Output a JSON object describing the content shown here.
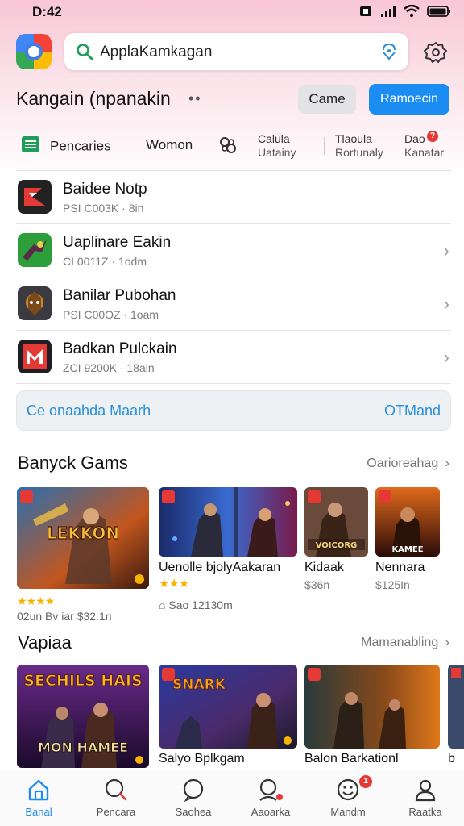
{
  "status_bar": {
    "time": "D:42"
  },
  "search": {
    "value": "ApplaKamkagan"
  },
  "header": {
    "title": "Kangain (npanakin",
    "game_button": "Came",
    "primary_button": "Ramoecin"
  },
  "tabs": [
    {
      "label": "Pencaries"
    },
    {
      "label": "Womon"
    },
    {
      "label": "Calula",
      "sub": "Uatainy"
    },
    {
      "label": "Tlaoula",
      "sub": "Rortunaly"
    },
    {
      "label": "Dao",
      "sub": "Kanatar",
      "badge": "?"
    }
  ],
  "list": [
    {
      "name": "Baidee Notp",
      "meta": "PSI C003K · 8in"
    },
    {
      "name": "Uaplinare Eakin",
      "meta": "CI 0011Z · 1odm"
    },
    {
      "name": "Banilar Pubohan",
      "meta": "PSI C00OZ · 1oam"
    },
    {
      "name": "Badkan Pulckain",
      "meta": "ZCI 9200K · 18ain"
    }
  ],
  "banner": {
    "left": "Ce onaahda Maarh",
    "right": "OTMand"
  },
  "section1": {
    "title": "Banyck Gams",
    "more": "Oarioreahag",
    "cards": [
      {
        "art_text": "LEKKON",
        "caption": "02un Bv iar $32.1n",
        "stars": "★★★★"
      },
      {
        "name": "Uenolle bjolyAakaran",
        "stars": "★★★",
        "caption": "Sao 12130m"
      },
      {
        "name": "Kidaak",
        "price": "$36n",
        "art_text": "VOICORG"
      },
      {
        "name": "Nennara",
        "price": "$125In",
        "art_text": "KAMEE"
      }
    ]
  },
  "section2": {
    "title": "Vapiaa",
    "more": "Mamanabling",
    "cards": [
      {
        "art_text": "SECHILS HAIS",
        "art_text2": "MON HAMEE"
      },
      {
        "name": "Salyo Bplkgam",
        "art_text": "SNARK"
      },
      {
        "name": "Balon Barkationl"
      },
      {
        "name": "b"
      }
    ]
  },
  "bottom_nav": [
    {
      "label": "Banal",
      "icon": "home-icon"
    },
    {
      "label": "Pencara",
      "icon": "search-icon"
    },
    {
      "label": "Saohea",
      "icon": "chat-icon"
    },
    {
      "label": "Aaoarka",
      "icon": "search-person-icon"
    },
    {
      "label": "Mandm",
      "icon": "smile-icon",
      "badge": "1"
    },
    {
      "label": "Raatka",
      "icon": "profile-icon"
    }
  ],
  "colors": {
    "accent": "#1a8cf2",
    "link": "#2a8fd8",
    "badge": "#e53935",
    "star": "#f5b400"
  }
}
